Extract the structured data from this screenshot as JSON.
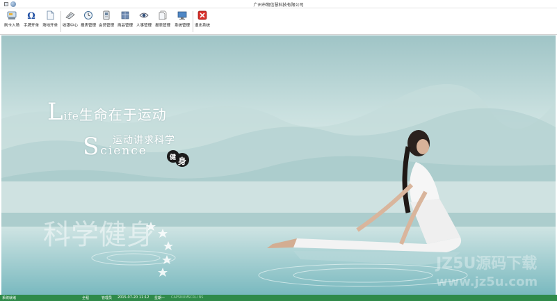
{
  "window": {
    "title": "广州市物信慧科技有限公司"
  },
  "toolbar": {
    "items": [
      {
        "label": "刷卡入场",
        "icon": "card-reader-icon"
      },
      {
        "label": "手牌开单",
        "icon": "omega-icon"
      },
      {
        "label": "场地开单",
        "icon": "document-icon"
      },
      {
        "label": "收银中心",
        "icon": "cash-register-icon"
      },
      {
        "label": "报表管理",
        "icon": "clock-icon"
      },
      {
        "label": "会员管理",
        "icon": "member-card-icon"
      },
      {
        "label": "商品管理",
        "icon": "goods-icon"
      },
      {
        "label": "人事管理",
        "icon": "eye-icon"
      },
      {
        "label": "报表管理",
        "icon": "report-icon"
      },
      {
        "label": "系统管理",
        "icon": "monitor-icon"
      },
      {
        "label": "退出系统",
        "icon": "exit-icon"
      }
    ]
  },
  "banner": {
    "line1_initial": "L",
    "line1_rest": "ife",
    "line1_cn": "生命在于运动",
    "line2_cn": "运动讲求科学",
    "line3_initial": "S",
    "line3_rest": "cience",
    "badge_char1": "健",
    "badge_char2": "身",
    "watermark_calligraphy": "科学健身",
    "watermark_site_cn": "JZ5U源码下载",
    "watermark_site_url": "www.jz5u.com"
  },
  "statusbar": {
    "system_status": "系统就绪",
    "scope": "全程",
    "user": "管理员",
    "date": "2015-07-20",
    "time": "11:12",
    "weekday": "星期一",
    "keys": [
      "CAPS",
      "NUM",
      "SCRL",
      "INS"
    ]
  },
  "colors": {
    "statusbar_bg": "#2f8a4a",
    "exit_icon": "#d9302b"
  }
}
